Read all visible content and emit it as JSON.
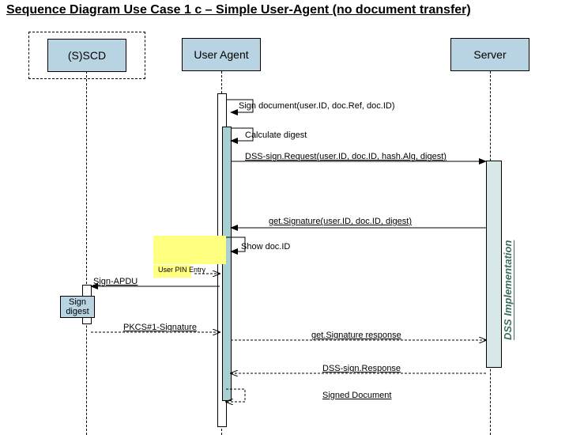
{
  "title": "Sequence Diagram Use Case 1 c – Simple User-Agent (no document transfer)",
  "participants": {
    "sscd": "(S)SCD",
    "user_agent": "User\nAgent",
    "server": "Server"
  },
  "messages": {
    "sign_doc": "Sign document(user.ID, doc.Ref, doc.ID)",
    "calc_digest": "Calculate digest",
    "dss_request": "DSS-sign.Request(user.ID, doc.ID, hash.Alg, digest)",
    "get_sig": "get.Signature(user.ID, doc.ID, digest)",
    "show_docid": "Show doc.ID",
    "user_pin": "User PIN Entry",
    "sign_apdu": "Sign-APDU",
    "sign_digest": "Sign\ndigest",
    "pkcs": "PKCS#1-Signature",
    "get_sig_resp": "get.Signature response",
    "dss_response": "DSS-sign.Response",
    "signed_doc": "Signed Document"
  },
  "dss_label": "DSS Implementation"
}
